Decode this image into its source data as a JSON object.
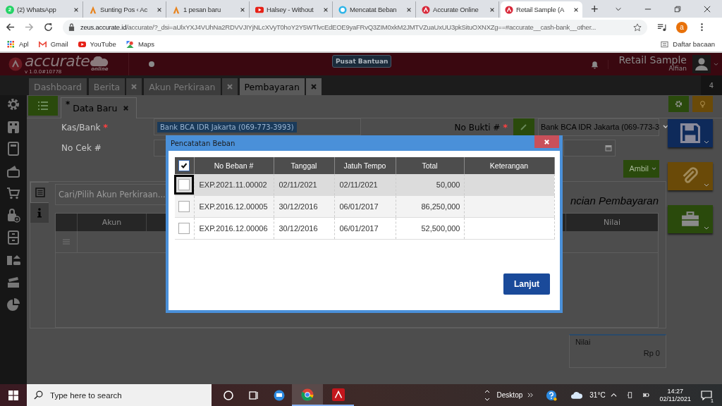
{
  "browser": {
    "tabs": [
      {
        "title": "(2) WhatsApp",
        "badge": "2",
        "selected": false
      },
      {
        "title": "Sunting Pos ‹ Ac",
        "selected": false
      },
      {
        "title": "1 pesan baru",
        "selected": false
      },
      {
        "title": "Halsey - Without",
        "selected": false
      },
      {
        "title": "Mencatat Beban",
        "selected": false
      },
      {
        "title": "Accurate Online",
        "selected": false
      },
      {
        "title": "Retail Sample (A",
        "selected": true
      }
    ],
    "new_tab": "+",
    "url_host": "zeus.accurate.id",
    "url_path": "/accurate/?_dsi=aUlxYXJ4VUhNa2RDVVJIYjNLcXVyT0hoY2Y5WTlvcEdEOE9yaFRvQ3ZIM0xkM2JMTVZuaUxUU3pkSituOXNXZg==#accurate__cash-bank__other...",
    "profile": "a",
    "bookmarks": [
      {
        "label": "Apl"
      },
      {
        "label": "Gmail"
      },
      {
        "label": "YouTube"
      },
      {
        "label": "Maps"
      }
    ],
    "reading_list": "Daftar bacaan"
  },
  "app": {
    "logo": "accurate",
    "logo_sub": "online",
    "version": "v 1.0.0#10778",
    "help": "Pusat Bantuan",
    "company": "Retail Sample",
    "user": "Alfian",
    "tabs": [
      {
        "label": "Dashboard",
        "closable": false,
        "selected": false
      },
      {
        "label": "Berita",
        "closable": true,
        "selected": false
      },
      {
        "label": "Akun Perkiraan",
        "closable": true,
        "selected": false
      },
      {
        "label": "Pembayaran",
        "closable": true,
        "selected": true
      }
    ],
    "tab_count": "4"
  },
  "form": {
    "doc_tab": {
      "mark": "*",
      "label": "Data Baru"
    },
    "kas_bank": {
      "label": "Kas/Bank",
      "required_mark": "*",
      "value": "Bank BCA IDR Jakarta (069-773-3993)"
    },
    "no_cek": {
      "label": "No Cek #"
    },
    "no_bukti": {
      "label": "No Bukti #",
      "required_mark": "*",
      "value": "Bank BCA IDR Jakarta (069-773-3"
    },
    "ambil": "Ambil",
    "search": {
      "placeholder": "Cari/Pilih Akun Perkiraan..."
    },
    "section_title": "ncian Pembayaran",
    "grid_columns": [
      "Akun",
      "Nilai"
    ],
    "summary": {
      "label": "Nilai",
      "value": "Rp 0"
    }
  },
  "modal": {
    "title": "Pencatatan Beban",
    "all_checked": true,
    "columns": [
      "No Beban #",
      "Tanggal",
      "Jatuh Tempo",
      "Total",
      "Keterangan"
    ],
    "rows": [
      {
        "no": "EXP.2021.11.00002",
        "tanggal": "02/11/2021",
        "jatuh_tempo": "02/11/2021",
        "total": "50,000",
        "checked": false,
        "selected": true
      },
      {
        "no": "EXP.2016.12.00005",
        "tanggal": "30/12/2016",
        "jatuh_tempo": "06/01/2017",
        "total": "86,250,000",
        "checked": false,
        "selected": false
      },
      {
        "no": "EXP.2016.12.00006",
        "tanggal": "30/12/2016",
        "jatuh_tempo": "06/01/2017",
        "total": "52,500,000",
        "checked": false,
        "selected": false
      }
    ],
    "button": "Lanjut"
  },
  "taskbar": {
    "search_placeholder": "Type here to search",
    "desktop": "Desktop",
    "temperature": "31°C",
    "time": "14:27",
    "date": "02/11/2021",
    "notifications": "1"
  }
}
